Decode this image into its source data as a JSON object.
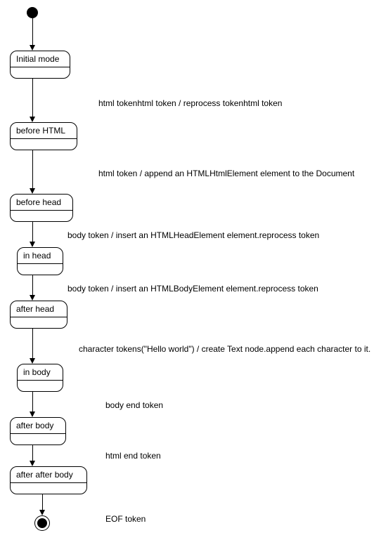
{
  "states": {
    "initial": "Initial mode",
    "before_html": "before HTML",
    "before_head": "before head",
    "in_head": "in head",
    "after_head": "after head",
    "in_body": "in body",
    "after_body": "after body",
    "after_after_body": "after after body"
  },
  "transitions": {
    "t1": "html tokenhtml token / reprocess tokenhtml token",
    "t2": "html token / append an HTMLHtmlElement element to the Document",
    "t3": "body token / insert an HTMLHeadElement element.reprocess token",
    "t4": "body token / insert an HTMLBodyElement element.reprocess token",
    "t5": "character tokens(\"Hello world\") / create Text node.append each character to it.",
    "t6": "body end token",
    "t7": "html end token",
    "t8": "EOF token"
  },
  "chart_data": {
    "type": "state-diagram",
    "title": "",
    "initial_state": true,
    "final_state": true,
    "states": [
      "Initial mode",
      "before HTML",
      "before head",
      "in head",
      "after head",
      "in body",
      "after body",
      "after after body"
    ],
    "transitions": [
      {
        "from": "START",
        "to": "Initial mode",
        "label": ""
      },
      {
        "from": "Initial mode",
        "to": "before HTML",
        "label": "html tokenhtml token / reprocess tokenhtml token"
      },
      {
        "from": "before HTML",
        "to": "before head",
        "label": "html token / append an HTMLHtmlElement element to the Document"
      },
      {
        "from": "before head",
        "to": "in head",
        "label": "body token / insert an HTMLHeadElement element.reprocess token"
      },
      {
        "from": "in head",
        "to": "after head",
        "label": "body token / insert an HTMLBodyElement element.reprocess token"
      },
      {
        "from": "after head",
        "to": "in body",
        "label": "character tokens(\"Hello world\") / create Text node.append each character to it."
      },
      {
        "from": "in body",
        "to": "after body",
        "label": "body end token"
      },
      {
        "from": "after body",
        "to": "after after body",
        "label": "html end token"
      },
      {
        "from": "after after body",
        "to": "END",
        "label": "EOF token"
      }
    ]
  }
}
